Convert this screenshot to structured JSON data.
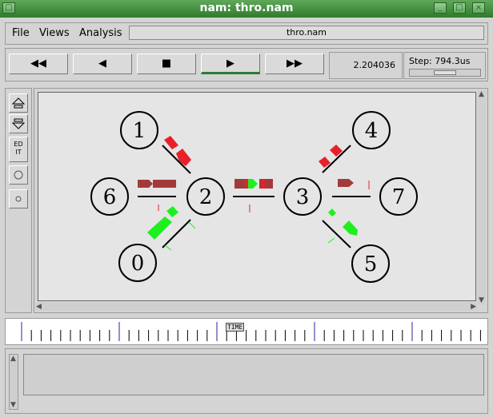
{
  "window": {
    "title": "nam: thro.nam",
    "btn_shade": "□",
    "btn_max": "□",
    "btn_close": "×"
  },
  "menu": {
    "file": "File",
    "views": "Views",
    "analysis": "Analysis",
    "filename": "thro.nam"
  },
  "controls": {
    "rewind_icon": "◀◀",
    "back_icon": "◀",
    "stop_icon": "■",
    "play_icon": "▶",
    "fastforward_icon": "▶▶",
    "time_value": "2.204036",
    "step_label": "Step: 794.3us",
    "step_slider_level": 0.5
  },
  "tools": {
    "edit_label": "EDIT",
    "zoom_in_icon": "zoom-in-icon",
    "zoom_out_icon": "zoom-out-icon"
  },
  "network": {
    "nodes": [
      "0",
      "1",
      "2",
      "3",
      "4",
      "5",
      "6",
      "7"
    ],
    "colors": {
      "red": "#e8202a",
      "darkred": "#a33a3a",
      "green": "#1ef01e",
      "node_stroke": "#000000"
    }
  },
  "timeline": {
    "label": "TIME"
  }
}
